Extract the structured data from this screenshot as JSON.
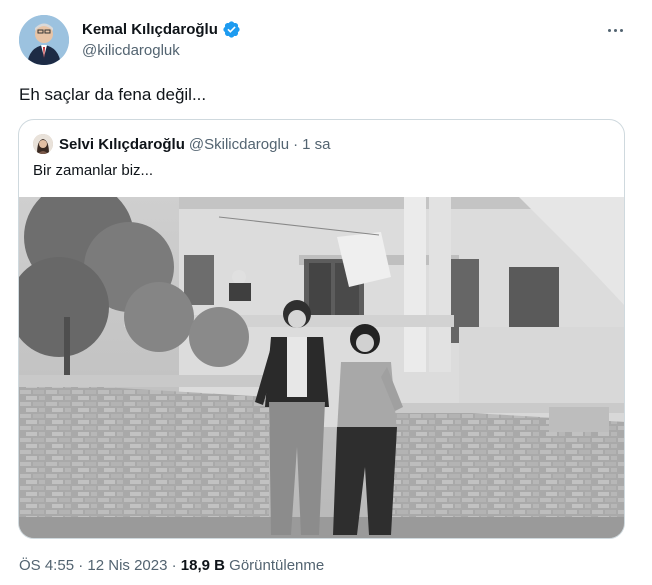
{
  "author": {
    "display_name": "Kemal Kılıçdaroğlu",
    "handle": "@kilicdarogluk",
    "verified": true
  },
  "tweet": {
    "text": "Eh saçlar da fena değil..."
  },
  "quoted_tweet": {
    "display_name": "Selvi Kılıçdaroğlu",
    "handle": "@Skilicdaroglu",
    "separator": "·",
    "time": "1 sa",
    "text": "Bir zamanlar biz..."
  },
  "meta": {
    "time": "ÖS 4:55",
    "separator1": "·",
    "date": "12 Nis 2023",
    "separator2": "·",
    "views_count": "18,9 B",
    "views_label": "Görüntülenme"
  },
  "colors": {
    "verified_blue": "#1d9bf0",
    "secondary_text": "#536471",
    "border": "#cfd9de"
  },
  "icons": {
    "verified": "verified-badge-icon",
    "more": "more-horizontal-icon"
  }
}
